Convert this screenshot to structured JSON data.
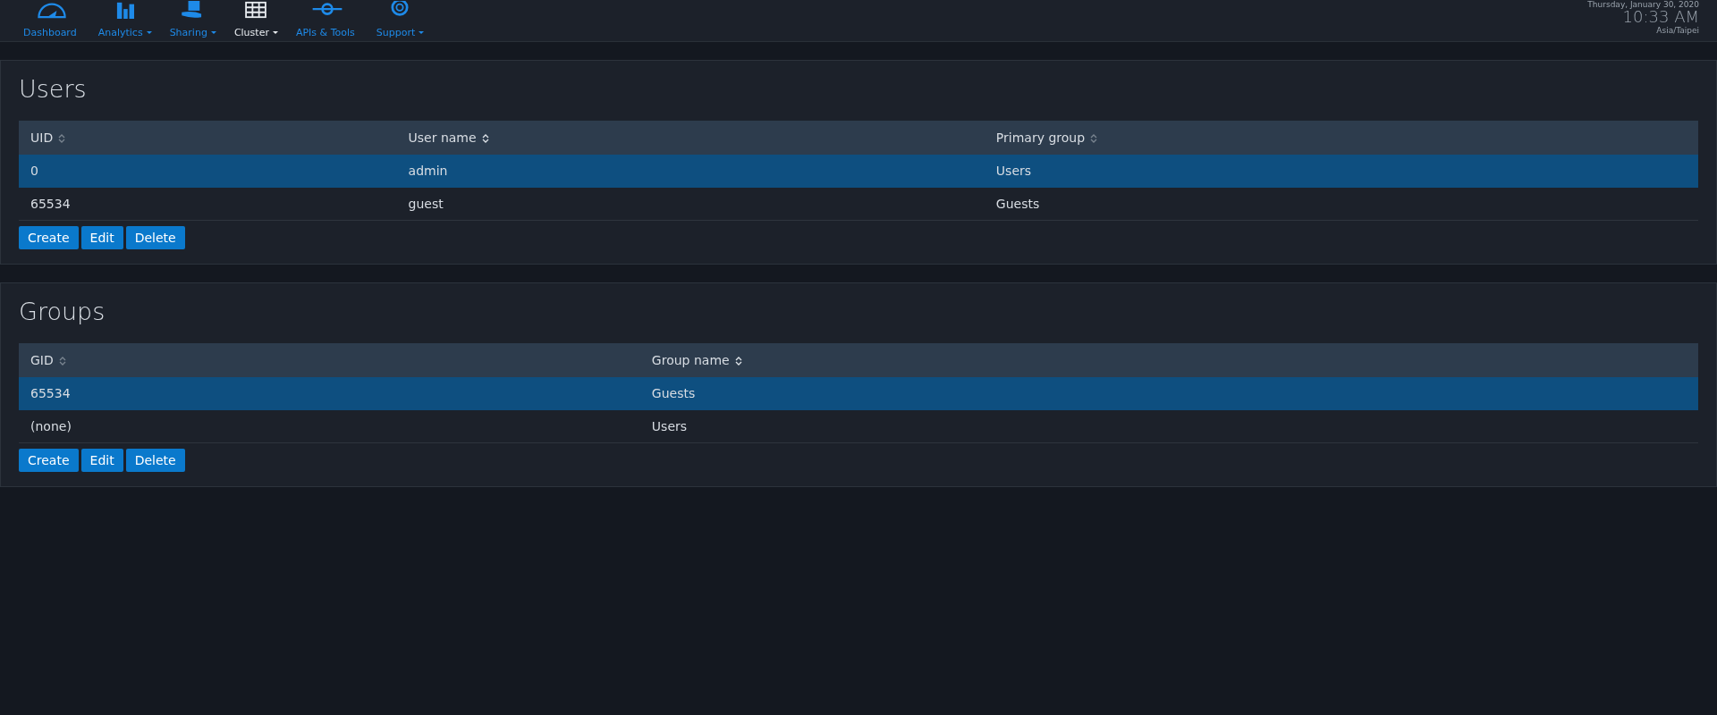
{
  "nav": [
    {
      "label": "Dashboard",
      "kind": "gauge",
      "dropdown": false,
      "selected": false
    },
    {
      "label": "Analytics",
      "kind": "bars",
      "dropdown": true,
      "selected": false
    },
    {
      "label": "Sharing",
      "kind": "share",
      "dropdown": true,
      "selected": false
    },
    {
      "label": "Cluster",
      "kind": "grid",
      "dropdown": true,
      "selected": true
    },
    {
      "label": "APIs & Tools",
      "kind": "plug",
      "dropdown": false,
      "selected": false
    },
    {
      "label": "Support",
      "kind": "lifebuoy",
      "dropdown": true,
      "selected": false
    }
  ],
  "clock": {
    "date": "Thursday, January 30, 2020",
    "time": "10:33 AM",
    "timezone": "Asia/Taipei"
  },
  "panels": [
    {
      "title": "Users",
      "columns": [
        {
          "label": "UID",
          "sorted": false
        },
        {
          "label": "User name",
          "sorted": true
        },
        {
          "label": "Primary group",
          "sorted": false
        }
      ],
      "rows": [
        {
          "cells": [
            "0",
            "admin",
            "Users"
          ],
          "selected": true
        },
        {
          "cells": [
            "65534",
            "guest",
            "Guests"
          ],
          "selected": false
        }
      ],
      "buttons": [
        "Create",
        "Edit",
        "Delete"
      ]
    },
    {
      "title": "Groups",
      "columns": [
        {
          "label": "GID",
          "sorted": false
        },
        {
          "label": "Group name",
          "sorted": true
        }
      ],
      "rows": [
        {
          "cells": [
            "65534",
            "Guests"
          ],
          "selected": true
        },
        {
          "cells": [
            "(none)",
            "Users"
          ],
          "selected": false
        }
      ],
      "buttons": [
        "Create",
        "Edit",
        "Delete"
      ]
    }
  ]
}
